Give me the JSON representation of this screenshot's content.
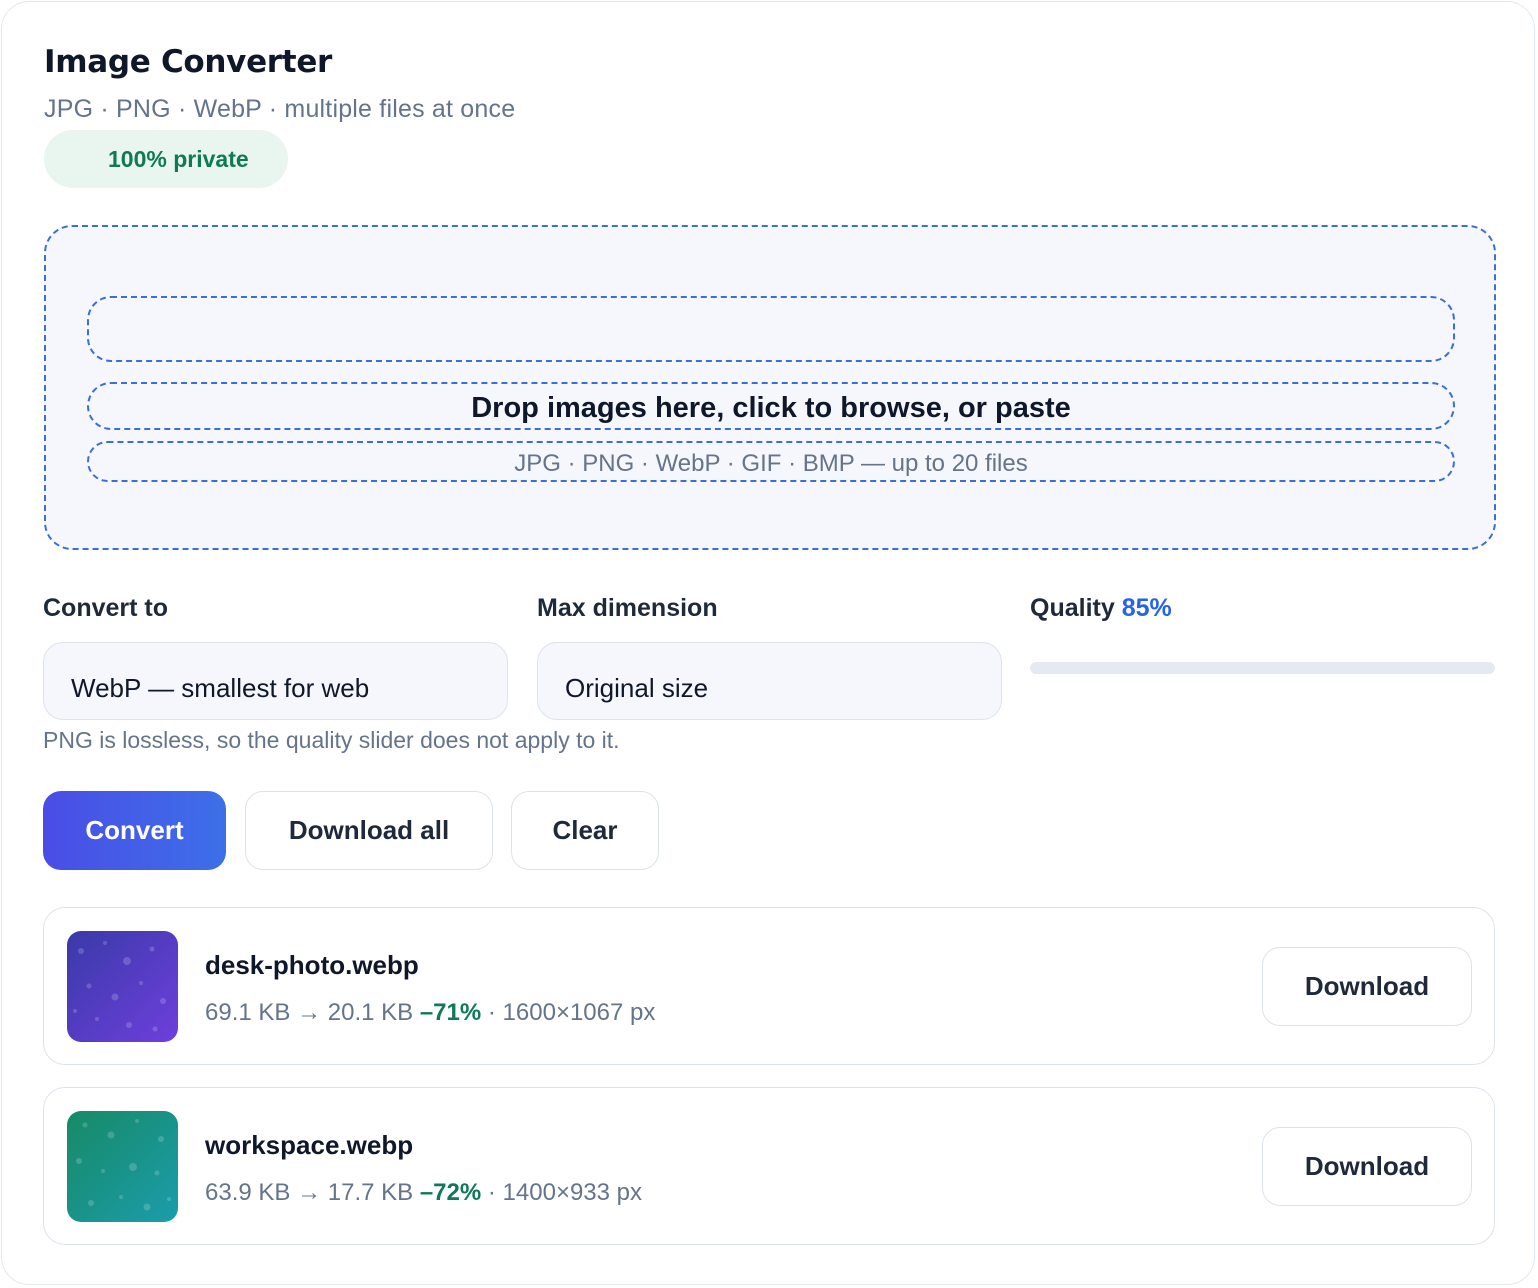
{
  "app": {
    "title": "Image Converter",
    "subtitle": "JPG · PNG · WebP · multiple files at once",
    "badge": "100% private"
  },
  "dropzone": {
    "title": "Drop images here, click to browse, or paste",
    "hint": "JPG · PNG · WebP · GIF · BMP — up to 20 files"
  },
  "settings": {
    "convert_to_label": "Convert to",
    "convert_to_value": "WebP — smallest for web",
    "max_dimension_label": "Max dimension",
    "max_dimension_value": "Original size",
    "quality_label": "Quality",
    "quality_value": "85%",
    "quality_level": 85,
    "note": "PNG is lossless, so the quality slider does not apply to it."
  },
  "actions": {
    "convert": "Convert",
    "download_all": "Download all",
    "clear": "Clear"
  },
  "files": [
    {
      "name": "desk-photo.webp",
      "original_size": "69.1 KB",
      "arrow": "→",
      "new_size": "20.1 KB",
      "saving": "–71%",
      "dimensions": "· 1600×1067 px",
      "download": "Download",
      "thumb_colors": [
        "#3b3fb0",
        "#6d3ed8"
      ]
    },
    {
      "name": "workspace.webp",
      "original_size": "63.9 KB",
      "arrow": "→",
      "new_size": "17.7 KB",
      "saving": "–72%",
      "dimensions": "· 1400×933 px",
      "download": "Download",
      "thumb_colors": [
        "#168f6f",
        "#1a9aa8"
      ]
    }
  ],
  "colors": {
    "accent": "#2563eb",
    "primary_button": "#4a4de6",
    "success": "#0f7a55",
    "dropzone_border": "#3b6fd8"
  }
}
